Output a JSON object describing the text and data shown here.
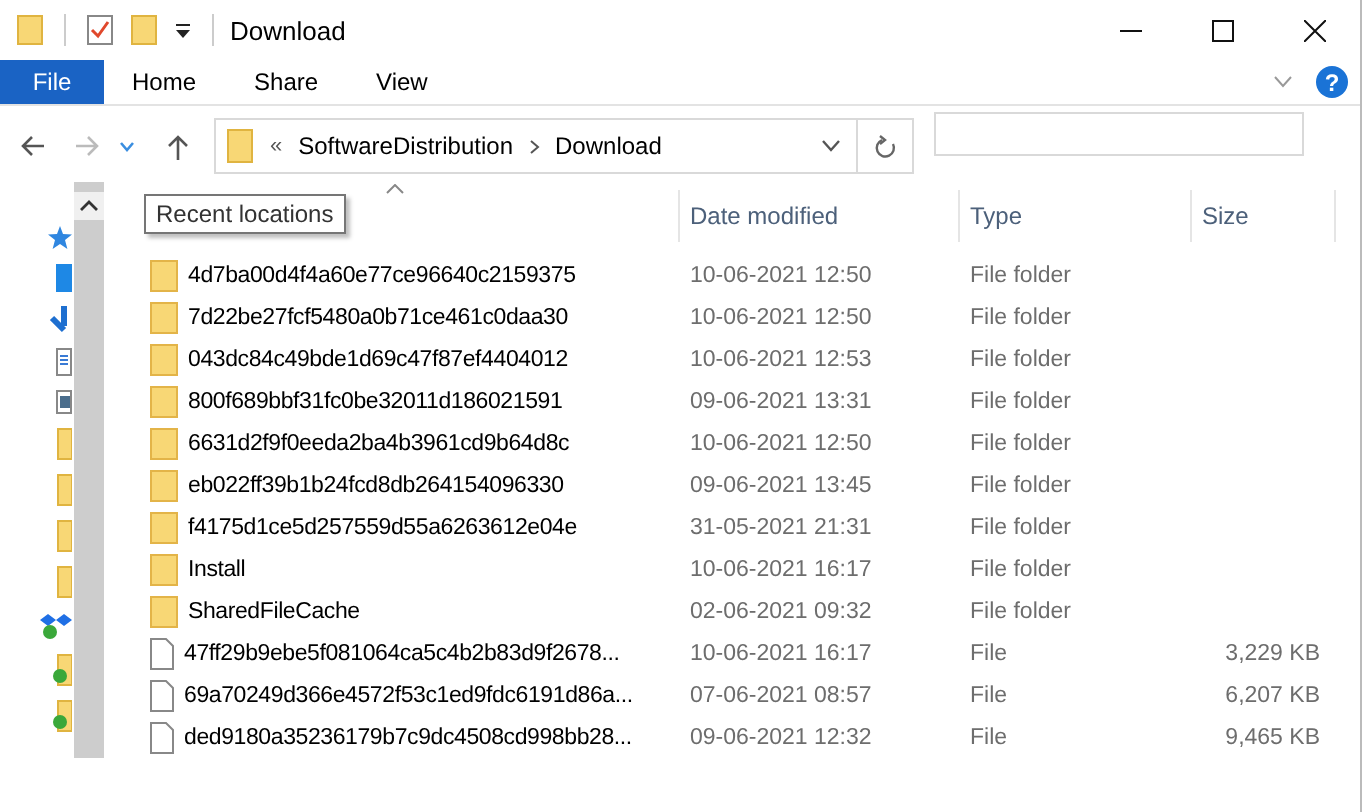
{
  "window": {
    "title": "Download"
  },
  "ribbon": {
    "file_tab": "File",
    "tabs": [
      "Home",
      "Share",
      "View"
    ],
    "help": "?"
  },
  "address": {
    "overflow": "«",
    "crumbs": [
      "SoftwareDistribution",
      "Download"
    ]
  },
  "tooltip": "Recent locations",
  "table": {
    "columns": [
      "Date modified",
      "Type",
      "Size"
    ],
    "rows": [
      {
        "kind": "folder",
        "name": "4d7ba00d4f4a60e77ce96640c2159375",
        "date": "10-06-2021 12:50",
        "type": "File folder"
      },
      {
        "kind": "folder",
        "name": "7d22be27fcf5480a0b71ce461c0daa30",
        "date": "10-06-2021 12:50",
        "type": "File folder"
      },
      {
        "kind": "folder",
        "name": "043dc84c49bde1d69c47f87ef4404012",
        "date": "10-06-2021 12:53",
        "type": "File folder"
      },
      {
        "kind": "folder",
        "name": "800f689bbf31fc0be32011d186021591",
        "date": "09-06-2021 13:31",
        "type": "File folder"
      },
      {
        "kind": "folder",
        "name": "6631d2f9f0eeda2ba4b3961cd9b64d8c",
        "date": "10-06-2021 12:50",
        "type": "File folder"
      },
      {
        "kind": "folder",
        "name": "eb022ff39b1b24fcd8db264154096330",
        "date": "09-06-2021 13:45",
        "type": "File folder"
      },
      {
        "kind": "folder",
        "name": "f4175d1ce5d257559d55a6263612e04e",
        "date": "31-05-2021 21:31",
        "type": "File folder"
      },
      {
        "kind": "folder",
        "name": "Install",
        "date": "10-06-2021 16:17",
        "type": "File folder"
      },
      {
        "kind": "folder",
        "name": "SharedFileCache",
        "date": "02-06-2021 09:32",
        "type": "File folder"
      },
      {
        "kind": "file",
        "name": "47ff29b9ebe5f081064ca5c4b2b83d9f2678...",
        "date": "10-06-2021 16:17",
        "type": "File",
        "size": "3,229 KB"
      },
      {
        "kind": "file",
        "name": "69a70249d366e4572f53c1ed9fdc6191d86a...",
        "date": "07-06-2021 08:57",
        "type": "File",
        "size": "6,207 KB"
      },
      {
        "kind": "file",
        "name": "ded9180a35236179b7c9dc4508cd998bb28...",
        "date": "09-06-2021 12:32",
        "type": "File",
        "size": "9,465 KB"
      }
    ]
  }
}
